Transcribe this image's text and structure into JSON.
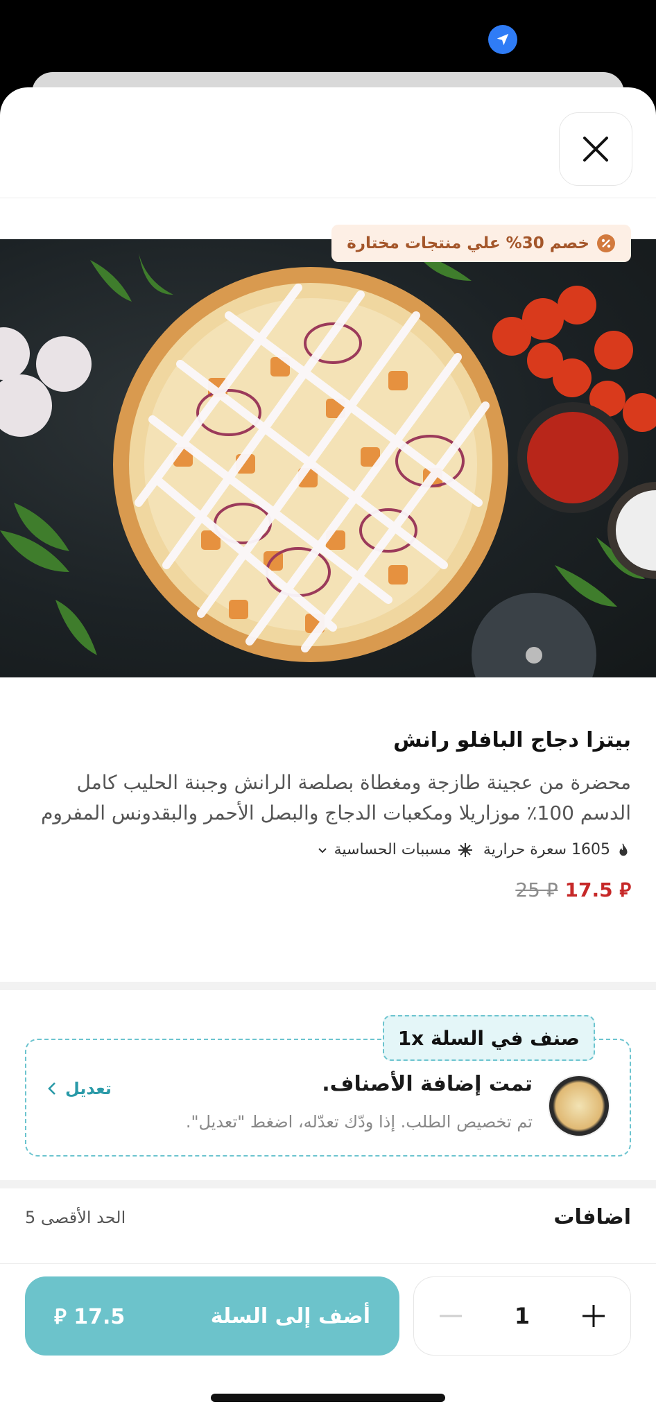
{
  "promo": {
    "label": "خصم 30% علي منتجات مختارة"
  },
  "product": {
    "title": "بيتزا دجاج البافلو رانش",
    "description": "محضرة من عجينة طازجة ومغطاة بصلصة الرانش وجبنة الحليب كامل الدسم 100٪ موزاريلا ومكعبات الدجاج والبصل الأحمر والبقدونس المفروم",
    "calories": "1605 سعرة حرارية",
    "allergens": "مسببات الحساسية",
    "price_new": "17.5",
    "price_old": "25",
    "currency_symbol": "⃁"
  },
  "cart": {
    "chip": "صنف في السلة 1x",
    "title": "تمت إضافة الأصناف.",
    "subtitle": "تم تخصيص الطلب. إذا ودّك تعدّله، اضغط \"تعديل\".",
    "edit_label": "تعديل"
  },
  "extras": {
    "title": "اضافات",
    "max_label": "الحد الأقصى 5"
  },
  "bottom": {
    "add_label": "أضف إلى السلة",
    "total": "17.5",
    "quantity": "1"
  },
  "colors": {
    "accent": "#6cc3cb",
    "price": "#c62828",
    "promo_text": "#a4562a",
    "location": "#2f7cf6"
  },
  "icons": [
    "location-arrow-icon",
    "close-icon",
    "discount-badge-icon",
    "flame-icon",
    "allergen-icon",
    "chevron-down-icon",
    "chevron-left-icon",
    "minus-icon",
    "plus-icon"
  ]
}
